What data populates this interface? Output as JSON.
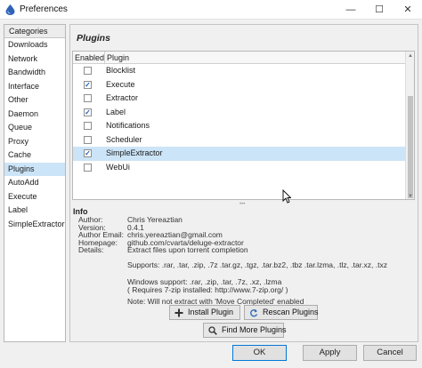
{
  "window": {
    "title": "Preferences",
    "minimize_glyph": "—",
    "maximize_glyph": "☐",
    "close_glyph": "✕"
  },
  "categories": {
    "header": "Categories",
    "items": [
      "Downloads",
      "Network",
      "Bandwidth",
      "Interface",
      "Other",
      "Daemon",
      "Queue",
      "Proxy",
      "Cache",
      "Plugins",
      "AutoAdd",
      "Execute",
      "Label",
      "SimpleExtractor"
    ],
    "selected_index": 9
  },
  "plugins": {
    "title": "Plugins",
    "columns": {
      "enabled": "Enabled",
      "plugin": "Plugin"
    },
    "rows": [
      {
        "name": "Blocklist",
        "enabled": false
      },
      {
        "name": "Execute",
        "enabled": true
      },
      {
        "name": "Extractor",
        "enabled": false
      },
      {
        "name": "Label",
        "enabled": true
      },
      {
        "name": "Notifications",
        "enabled": false
      },
      {
        "name": "Scheduler",
        "enabled": false
      },
      {
        "name": "SimpleExtractor",
        "enabled": true
      },
      {
        "name": "WebUi",
        "enabled": false
      }
    ],
    "selected_index": 6,
    "check_glyph": "✓"
  },
  "info": {
    "title": "Info",
    "fields": [
      {
        "label": "Author:",
        "value": "Chris Yereaztian"
      },
      {
        "label": "Version:",
        "value": "0.4.1"
      },
      {
        "label": "Author Email:",
        "value": "chris.yereaztian@gmail.com"
      },
      {
        "label": "Homepage:",
        "value": "github.com/cvarta/deluge-extractor"
      },
      {
        "label": "Details:",
        "value": "Extract files upon torrent completion"
      }
    ],
    "supports": "Supports: .rar, .tar, .zip, .7z .tar.gz, .tgz, .tar.bz2, .tbz .tar.lzma, .tlz, .tar.xz, .txz",
    "windows_support": "Windows support: .rar, .zip, .tar, .7z, .xz, .lzma",
    "requires": "( Requires 7-zip installed: http://www.7-zip.org/ )",
    "note": "Note: Will not extract with 'Move Completed' enabled"
  },
  "buttons": {
    "install": "Install Plugin",
    "rescan": "Rescan Plugins",
    "find_more": "Find More Plugins",
    "ok": "OK",
    "apply": "Apply",
    "cancel": "Cancel"
  },
  "colors": {
    "selection": "#cce4f7",
    "default_button_border": "#0078d7",
    "checkmark": "#1f5fb5"
  }
}
